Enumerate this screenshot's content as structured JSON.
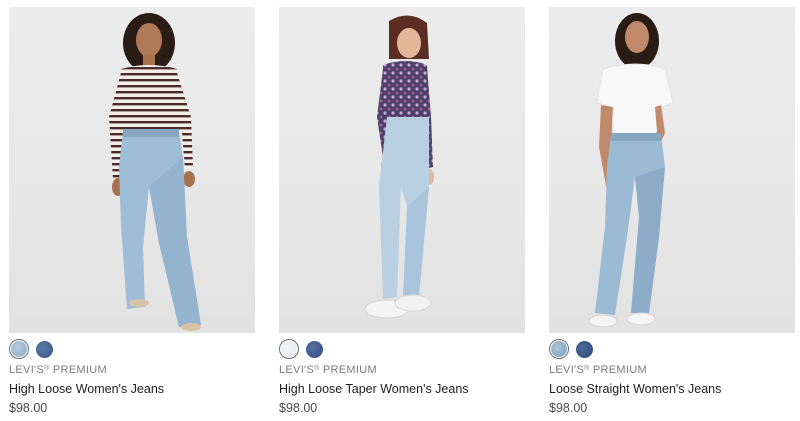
{
  "products": [
    {
      "brand": "LEVI'S",
      "brand_mark": "®",
      "brand_suffix": " PREMIUM",
      "name": "High Loose Women's Jeans",
      "price": "$98.00",
      "swatch_colors": [
        "#9ab6cf",
        "#3f5f8f"
      ],
      "image_desc": "model-stripe-top-light-wash"
    },
    {
      "brand": "LEVI'S",
      "brand_mark": "®",
      "brand_suffix": " PREMIUM",
      "name": "High Loose Taper Women's Jeans",
      "price": "$98.00",
      "swatch_colors": [
        "#e9eef2",
        "#3b5689"
      ],
      "image_desc": "model-floral-top-light-wash"
    },
    {
      "brand": "LEVI'S",
      "brand_mark": "®",
      "brand_suffix": " PREMIUM",
      "name": "Loose Straight Women's Jeans",
      "price": "$98.00",
      "swatch_colors": [
        "#8fb0cc",
        "#334c7d"
      ],
      "image_desc": "model-white-tee-light-wash"
    }
  ],
  "colors": {
    "background": "#ffffff",
    "photo_bg": "#e9e9e9",
    "brand_text": "#7b7b7b",
    "name_text": "#1e1e1e",
    "price_text": "#4a4a4a",
    "denim_light": "#a9c3d9",
    "denim_mid": "#8fb0cc"
  }
}
